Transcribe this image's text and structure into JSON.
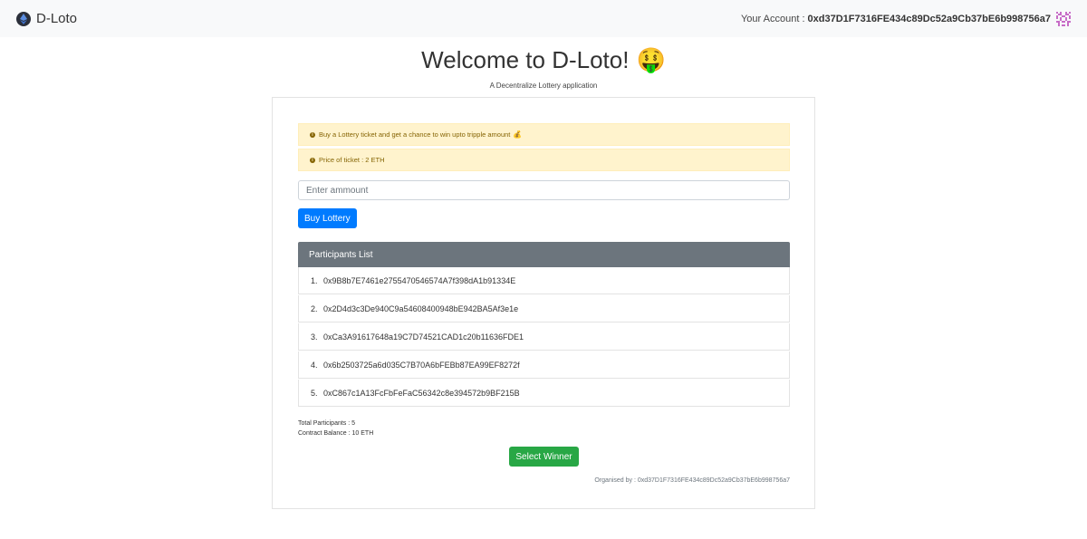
{
  "navbar": {
    "brand": "D-Loto",
    "account_label": "Your Account :",
    "account_address": "0xd37D1F7316FE434c89Dc52a9Cb37bE6b998756a7"
  },
  "header": {
    "title": "Welcome to D-Loto!",
    "title_emoji": "🤑",
    "subtitle": "A Decentralize Lottery application"
  },
  "alerts": [
    {
      "text": "Buy a Lottery ticket and get a chance to win upto tripple amount",
      "emoji": "💰"
    },
    {
      "text": "Price of ticket : 2 ETH",
      "emoji": ""
    }
  ],
  "form": {
    "amount_placeholder": "Enter ammount",
    "amount_value": "",
    "buy_label": "Buy Lottery"
  },
  "participants": {
    "header": "Participants List",
    "items": [
      {
        "num": "1.",
        "address": "0x9B8b7E7461e2755470546574A7f398dA1b91334E"
      },
      {
        "num": "2.",
        "address": "0x2D4d3c3De940C9a54608400948bE942BA5Af3e1e"
      },
      {
        "num": "3.",
        "address": "0xCa3A91617648a19C7D74521CAD1c20b11636FDE1"
      },
      {
        "num": "4.",
        "address": "0x6b2503725a6d035C7B70A6bFEBb87EA99EF8272f"
      },
      {
        "num": "5.",
        "address": "0xC867c1A13FcFbFeFaC56342c8e394572b9BF215B"
      }
    ]
  },
  "stats": {
    "total_participants": "Total Participants : 5",
    "contract_balance": "Contract Balance : 10 ETH"
  },
  "select_winner_label": "Select Winner",
  "organiser": "Organised by : 0xd37D1F7316FE434c89Dc52a9Cb37bE6b998756a7",
  "colors": {
    "primary": "#007bff",
    "success": "#28a745",
    "list_header": "#6c757d",
    "alert_bg": "#fff3cd"
  }
}
